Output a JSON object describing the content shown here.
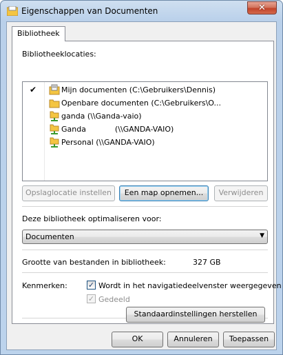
{
  "window": {
    "title": "Eigenschappen van Documenten",
    "close_glyph": "✕",
    "icon": "library-icon"
  },
  "tabs": [
    {
      "label": "Bibliotheek",
      "selected": true
    }
  ],
  "locations": {
    "heading": "Bibliotheeklocaties:",
    "items": [
      {
        "label": "Mijn documenten (C:\\Gebruikers\\Dennis)",
        "checked": true,
        "icon": "documents-folder-icon"
      },
      {
        "label": "Openbare documenten (C:\\Gebruikers\\O...",
        "checked": false,
        "icon": "folder-icon"
      },
      {
        "label": "ganda (\\\\Ganda-vaio)",
        "checked": false,
        "icon": "network-folder-icon"
      },
      {
        "label": "Ganda            (\\\\GANDA-VAIO)",
        "checked": false,
        "icon": "network-folder-icon"
      },
      {
        "label": "Personal (\\\\GANDA-VAIO)",
        "checked": false,
        "icon": "network-folder-icon"
      }
    ],
    "check_glyph": "✔"
  },
  "location_buttons": {
    "set_save_location": "Opslaglocatie instellen",
    "include_folder": "Een map opnemen...",
    "remove": "Verwijderen"
  },
  "optimize": {
    "label": "Deze bibliotheek optimaliseren voor:",
    "selected": "Documenten",
    "arrow_glyph": "▼"
  },
  "size": {
    "label": "Grootte van bestanden in bibliotheek:",
    "value": "327 GB"
  },
  "attributes": {
    "label": "Kenmerken:",
    "show_in_nav": {
      "label": "Wordt in het navigatiedeelvenster weergegeven",
      "checked": true,
      "enabled": true
    },
    "shared": {
      "label": "Gedeeld",
      "checked": true,
      "enabled": false
    },
    "check_glyph": "✓"
  },
  "restore_defaults": "Standaardinstellingen herstellen",
  "dialog_buttons": {
    "ok": "OK",
    "cancel": "Annuleren",
    "apply": "Toepassen"
  },
  "colors": {
    "focus_border": "#3c7fb1",
    "folder_yellow": "#f4c542",
    "close_red": "#c1432a"
  }
}
